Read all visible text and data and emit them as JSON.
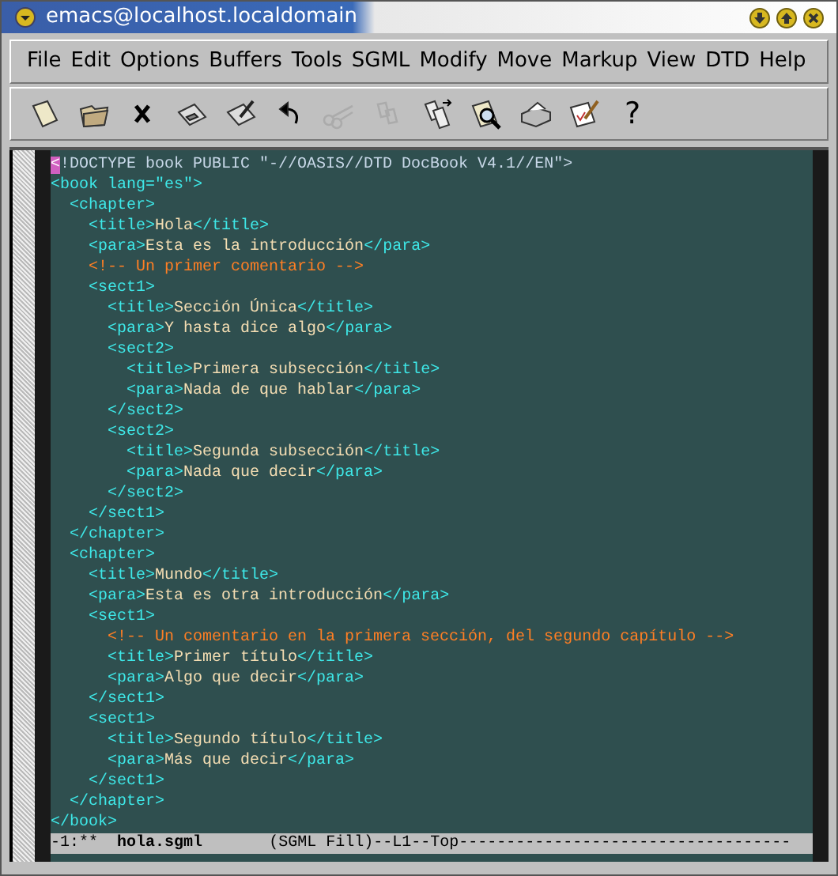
{
  "window": {
    "title": "emacs@localhost.localdomain"
  },
  "menu": [
    "File",
    "Edit",
    "Options",
    "Buffers",
    "Tools",
    "SGML",
    "Modify",
    "Move",
    "Markup",
    "View",
    "DTD",
    "Help"
  ],
  "toolbar": [
    {
      "kind": "new",
      "disabled": false
    },
    {
      "kind": "open",
      "disabled": false
    },
    {
      "kind": "close",
      "disabled": false
    },
    {
      "kind": "save",
      "disabled": false
    },
    {
      "kind": "saveas",
      "disabled": false
    },
    {
      "kind": "undo",
      "disabled": false
    },
    {
      "kind": "cut",
      "disabled": true
    },
    {
      "kind": "copy",
      "disabled": true
    },
    {
      "kind": "paste",
      "disabled": false
    },
    {
      "kind": "search",
      "disabled": false
    },
    {
      "kind": "print",
      "disabled": false
    },
    {
      "kind": "spell",
      "disabled": false
    },
    {
      "kind": "help",
      "glyph": "?",
      "disabled": false
    }
  ],
  "editor": {
    "lines": [
      {
        "segments": [
          {
            "kind": "cursor",
            "text": "<"
          },
          {
            "kind": "doctype",
            "text": "!DOCTYPE book PUBLIC \"-//OASIS//DTD DocBook V4.1//EN\">"
          }
        ]
      },
      {
        "segments": [
          {
            "kind": "tag",
            "text": "<book lang=\"es\">"
          }
        ],
        "children": [
          {
            "segments": [
              {
                "kind": "tag",
                "text": "<chapter>"
              }
            ],
            "children": [
              {
                "segments": [
                  {
                    "kind": "tag",
                    "text": "<title>"
                  },
                  {
                    "kind": "text",
                    "text": "Hola"
                  },
                  {
                    "kind": "tag",
                    "text": "</title>"
                  }
                ]
              },
              {
                "segments": [
                  {
                    "kind": "tag",
                    "text": "<para>"
                  },
                  {
                    "kind": "text",
                    "text": "Esta es la introducción"
                  },
                  {
                    "kind": "tag",
                    "text": "</para>"
                  }
                ]
              },
              {
                "segments": [
                  {
                    "kind": "comment",
                    "text": "<!-- Un primer comentario -->"
                  }
                ]
              },
              {
                "segments": [
                  {
                    "kind": "tag",
                    "text": "<sect1>"
                  }
                ],
                "children": [
                  {
                    "segments": [
                      {
                        "kind": "tag",
                        "text": "<title>"
                      },
                      {
                        "kind": "text",
                        "text": "Sección Única"
                      },
                      {
                        "kind": "tag",
                        "text": "</title>"
                      }
                    ]
                  },
                  {
                    "segments": [
                      {
                        "kind": "tag",
                        "text": "<para>"
                      },
                      {
                        "kind": "text",
                        "text": "Y hasta dice algo"
                      },
                      {
                        "kind": "tag",
                        "text": "</para>"
                      }
                    ]
                  },
                  {
                    "segments": [
                      {
                        "kind": "tag",
                        "text": "<sect2>"
                      }
                    ],
                    "children": [
                      {
                        "segments": [
                          {
                            "kind": "tag",
                            "text": "<title>"
                          },
                          {
                            "kind": "text",
                            "text": "Primera subsección"
                          },
                          {
                            "kind": "tag",
                            "text": "</title>"
                          }
                        ]
                      },
                      {
                        "segments": [
                          {
                            "kind": "tag",
                            "text": "<para>"
                          },
                          {
                            "kind": "text",
                            "text": "Nada de que hablar"
                          },
                          {
                            "kind": "tag",
                            "text": "</para>"
                          }
                        ]
                      }
                    ]
                  },
                  {
                    "segments": [
                      {
                        "kind": "tag",
                        "text": "</sect2>"
                      }
                    ]
                  },
                  {
                    "segments": [
                      {
                        "kind": "tag",
                        "text": "<sect2>"
                      }
                    ],
                    "children": [
                      {
                        "segments": [
                          {
                            "kind": "tag",
                            "text": "<title>"
                          },
                          {
                            "kind": "text",
                            "text": "Segunda subsección"
                          },
                          {
                            "kind": "tag",
                            "text": "</title>"
                          }
                        ]
                      },
                      {
                        "segments": [
                          {
                            "kind": "tag",
                            "text": "<para>"
                          },
                          {
                            "kind": "text",
                            "text": "Nada que decir"
                          },
                          {
                            "kind": "tag",
                            "text": "</para>"
                          }
                        ]
                      }
                    ]
                  },
                  {
                    "segments": [
                      {
                        "kind": "tag",
                        "text": "</sect2>"
                      }
                    ]
                  }
                ]
              },
              {
                "segments": [
                  {
                    "kind": "tag",
                    "text": "</sect1>"
                  }
                ]
              }
            ]
          },
          {
            "segments": [
              {
                "kind": "tag",
                "text": "</chapter>"
              }
            ]
          },
          {
            "segments": [
              {
                "kind": "tag",
                "text": "<chapter>"
              }
            ],
            "children": [
              {
                "segments": [
                  {
                    "kind": "tag",
                    "text": "<title>"
                  },
                  {
                    "kind": "text",
                    "text": "Mundo"
                  },
                  {
                    "kind": "tag",
                    "text": "</title>"
                  }
                ]
              },
              {
                "segments": [
                  {
                    "kind": "tag",
                    "text": "<para>"
                  },
                  {
                    "kind": "text",
                    "text": "Esta es otra introducción"
                  },
                  {
                    "kind": "tag",
                    "text": "</para>"
                  }
                ]
              },
              {
                "segments": [
                  {
                    "kind": "tag",
                    "text": "<sect1>"
                  }
                ],
                "children": [
                  {
                    "segments": [
                      {
                        "kind": "comment",
                        "text": "<!-- Un comentario en la primera sección, del segundo capítulo -->"
                      }
                    ]
                  },
                  {
                    "segments": [
                      {
                        "kind": "tag",
                        "text": "<title>"
                      },
                      {
                        "kind": "text",
                        "text": "Primer título"
                      },
                      {
                        "kind": "tag",
                        "text": "</title>"
                      }
                    ]
                  },
                  {
                    "segments": [
                      {
                        "kind": "tag",
                        "text": "<para>"
                      },
                      {
                        "kind": "text",
                        "text": "Algo que decir"
                      },
                      {
                        "kind": "tag",
                        "text": "</para>"
                      }
                    ]
                  }
                ]
              },
              {
                "segments": [
                  {
                    "kind": "tag",
                    "text": "</sect1>"
                  }
                ]
              },
              {
                "segments": [
                  {
                    "kind": "tag",
                    "text": "<sect1>"
                  }
                ],
                "children": [
                  {
                    "segments": [
                      {
                        "kind": "tag",
                        "text": "<title>"
                      },
                      {
                        "kind": "text",
                        "text": "Segundo título"
                      },
                      {
                        "kind": "tag",
                        "text": "</title>"
                      }
                    ]
                  },
                  {
                    "segments": [
                      {
                        "kind": "tag",
                        "text": "<para>"
                      },
                      {
                        "kind": "text",
                        "text": "Más que decir"
                      },
                      {
                        "kind": "tag",
                        "text": "</para>"
                      }
                    ]
                  }
                ]
              },
              {
                "segments": [
                  {
                    "kind": "tag",
                    "text": "</sect1>"
                  }
                ]
              }
            ]
          },
          {
            "segments": [
              {
                "kind": "tag",
                "text": "</chapter>"
              }
            ]
          }
        ]
      },
      {
        "segments": [
          {
            "kind": "tag",
            "text": "</book>"
          }
        ]
      }
    ]
  },
  "mode_line": {
    "status": "-1:**",
    "buffer": "hola.sgml",
    "info": "(SGML Fill)--L1--Top-----------------------------------"
  }
}
